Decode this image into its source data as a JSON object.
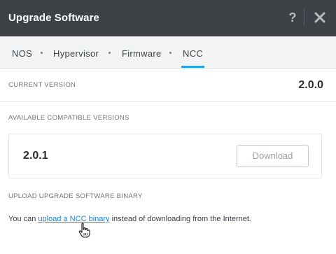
{
  "header": {
    "title": "Upgrade Software",
    "help_label": "?",
    "icons": {
      "help": "help-icon",
      "close": "close-icon"
    }
  },
  "tabs": [
    {
      "label": "NOS",
      "active": false
    },
    {
      "label": "Hypervisor",
      "active": false
    },
    {
      "label": "Firmware",
      "active": false
    },
    {
      "label": "NCC",
      "active": true
    }
  ],
  "current": {
    "label": "CURRENT VERSION",
    "value": "2.0.0"
  },
  "available": {
    "label": "AVAILABLE COMPATIBLE VERSIONS",
    "versions": [
      {
        "version": "2.0.1",
        "button": "Download"
      }
    ]
  },
  "upload": {
    "label": "UPLOAD UPGRADE SOFTWARE BINARY",
    "text_before": "You can ",
    "link": "upload a NCC binary",
    "text_after": " instead of downloading from the Internet."
  },
  "colors": {
    "header_bg": "#3e4146",
    "tab_active_underline": "#23a8e6",
    "link": "#1e87c8"
  }
}
